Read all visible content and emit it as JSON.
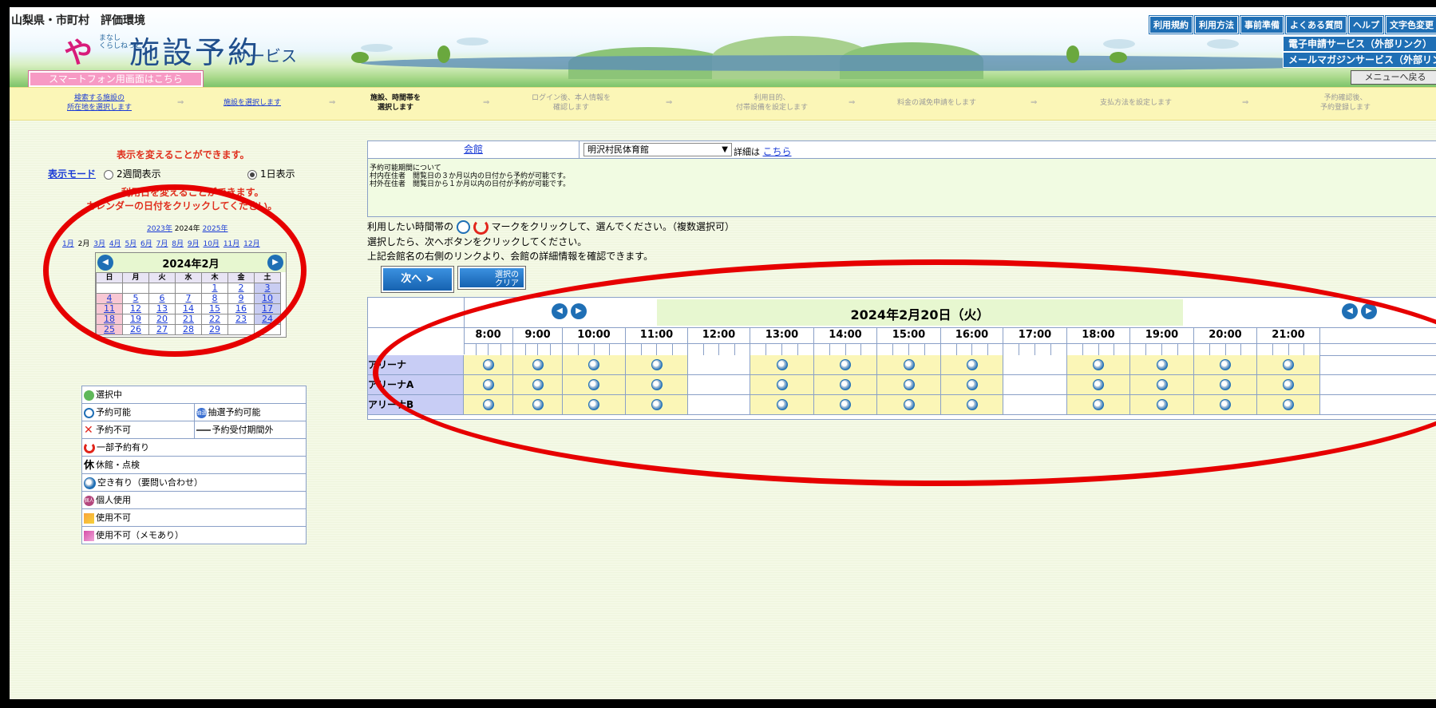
{
  "header": {
    "region_title": "山梨県・市町村　評価環境",
    "logo_ya": "や",
    "logo_small_1": "まなし",
    "logo_small_2": "くらしねっと",
    "logo_main": "施設予約",
    "logo_sub": "サービス",
    "smartphone_link": "スマートフォン用画面はこちら",
    "top_buttons": [
      "利用規約",
      "利用方法",
      "事前準備",
      "よくある質問",
      "ヘルプ",
      "文字色変更"
    ],
    "ext_link_1": "電子申請サービス（外部リンク）",
    "ext_link_2": "メールマガジンサービス（外部リンク）",
    "menu_back": "メニューへ戻る"
  },
  "steps": [
    {
      "line1": "検索する施設の",
      "line2": "所在地を選択します",
      "state": "link"
    },
    {
      "line1": "施設を選択します",
      "line2": "",
      "state": "link"
    },
    {
      "line1": "施設、時間帯を",
      "line2": "選択します",
      "state": "current"
    },
    {
      "line1": "ログイン後、本人情報を",
      "line2": "確認します",
      "state": "future"
    },
    {
      "line1": "利用目的、",
      "line2": "付帯設備を設定します",
      "state": "future"
    },
    {
      "line1": "料金の減免申請をします",
      "line2": "",
      "state": "future"
    },
    {
      "line1": "支払方法を設定します",
      "line2": "",
      "state": "future"
    },
    {
      "line1": "予約確認後、",
      "line2": "予約登録します",
      "state": "future"
    }
  ],
  "step_arrow": "⇒",
  "left": {
    "note_display": "表示を変えることができます。",
    "mode_label": "表示モード",
    "mode_2w": "2週間表示",
    "mode_1d": "1日表示",
    "note_date_1": "利用日を変えることができます。",
    "note_date_2": "カレンダーの日付をクリックしてください。",
    "years": {
      "prev": "2023年",
      "current": "2024年",
      "next": "2025年"
    },
    "months": [
      "1月",
      "2月",
      "3月",
      "4月",
      "5月",
      "6月",
      "7月",
      "8月",
      "9月",
      "10月",
      "11月",
      "12月"
    ],
    "current_month_index": 1
  },
  "calendar": {
    "title": "2024年2月",
    "prev_icon": "◀",
    "next_icon": "▶",
    "weekdays": [
      "日",
      "月",
      "火",
      "水",
      "木",
      "金",
      "土"
    ],
    "weeks": [
      [
        "",
        "",
        "",
        "",
        "1",
        "2",
        "3"
      ],
      [
        "4",
        "5",
        "6",
        "7",
        "8",
        "9",
        "10"
      ],
      [
        "11",
        "12",
        "13",
        "14",
        "15",
        "16",
        "17"
      ],
      [
        "18",
        "19",
        "20",
        "21",
        "22",
        "23",
        "24"
      ],
      [
        "25",
        "26",
        "27",
        "28",
        "29",
        "",
        ""
      ]
    ]
  },
  "legend": [
    [
      {
        "icon": "selected-icon",
        "text": "選択中"
      }
    ],
    [
      {
        "icon": "available-icon",
        "text": "予約可能"
      },
      {
        "icon": "lottery-icon",
        "text": "抽選予約可能",
        "icon_text": "抽選"
      }
    ],
    [
      {
        "icon": "unavailable-icon",
        "text": "予約不可"
      },
      {
        "icon": "out-of-period-icon",
        "text": "予約受付期間外"
      }
    ],
    [
      {
        "icon": "partial-icon",
        "text": "一部予約有り"
      }
    ],
    [
      {
        "icon": "closed-icon",
        "text": "休館・点検",
        "icon_text": "休"
      }
    ],
    [
      {
        "icon": "inquiry-icon",
        "text": "空き有り（要問い合わせ）"
      }
    ],
    [
      {
        "icon": "private-use-icon",
        "text": "個人使用",
        "icon_text": "個人"
      }
    ],
    [
      {
        "icon": "not-usable-icon",
        "text": "使用不可"
      }
    ],
    [
      {
        "icon": "not-usable-memo-icon",
        "text": "使用不可（メモあり）"
      }
    ]
  ],
  "facility": {
    "category_link": "会館",
    "selected": "明沢村民体育館",
    "detail_prefix": "詳細は",
    "detail_link": "こちら",
    "notice_1": "予約可能期間について",
    "notice_2": "村内在住者　閲覧日の３か月以内の日付から予約が可能です。",
    "notice_3": "村外在住者　閲覧日から１か月以内の日付が予約が可能です。"
  },
  "instructions": {
    "line1_a": "利用したい時間帯の",
    "line1_b": "マークをクリックして、選んでください。（複数選択可）",
    "line2": "選択したら、次へボタンをクリックしてください。",
    "line3": "上記会館名の右側のリンクより、会館の詳細情報を確認できます。"
  },
  "buttons": {
    "next": "次へ",
    "clear_1": "選択の",
    "clear_2": "クリア"
  },
  "schedule": {
    "date": "2024年2月20日（火）",
    "hours": [
      "8:00",
      "9:00",
      "10:00",
      "11:00",
      "12:00",
      "13:00",
      "14:00",
      "15:00",
      "16:00",
      "17:00",
      "18:00",
      "19:00",
      "20:00",
      "21:00"
    ],
    "rows": [
      {
        "label": "アリーナ",
        "status": [
          "inquiry",
          "inquiry",
          "inquiry",
          "inquiry",
          "none",
          "inquiry",
          "inquiry",
          "inquiry",
          "inquiry",
          "none",
          "inquiry",
          "inquiry",
          "inquiry",
          "inquiry"
        ]
      },
      {
        "label": "アリーナA",
        "status": [
          "inquiry",
          "inquiry",
          "inquiry",
          "inquiry",
          "none",
          "inquiry",
          "inquiry",
          "inquiry",
          "inquiry",
          "none",
          "inquiry",
          "inquiry",
          "inquiry",
          "inquiry"
        ]
      },
      {
        "label": "アリーナB",
        "status": [
          "inquiry",
          "inquiry",
          "inquiry",
          "inquiry",
          "none",
          "inquiry",
          "inquiry",
          "inquiry",
          "inquiry",
          "none",
          "inquiry",
          "inquiry",
          "inquiry",
          "inquiry"
        ]
      }
    ]
  },
  "colors": {
    "accent_blue": "#1f6fb5",
    "annotation_red": "#e60000",
    "slot_yellow": "#fbf6b7",
    "row_label_lavender": "#c8cdf5",
    "date_band_green": "#e7f7d0"
  }
}
